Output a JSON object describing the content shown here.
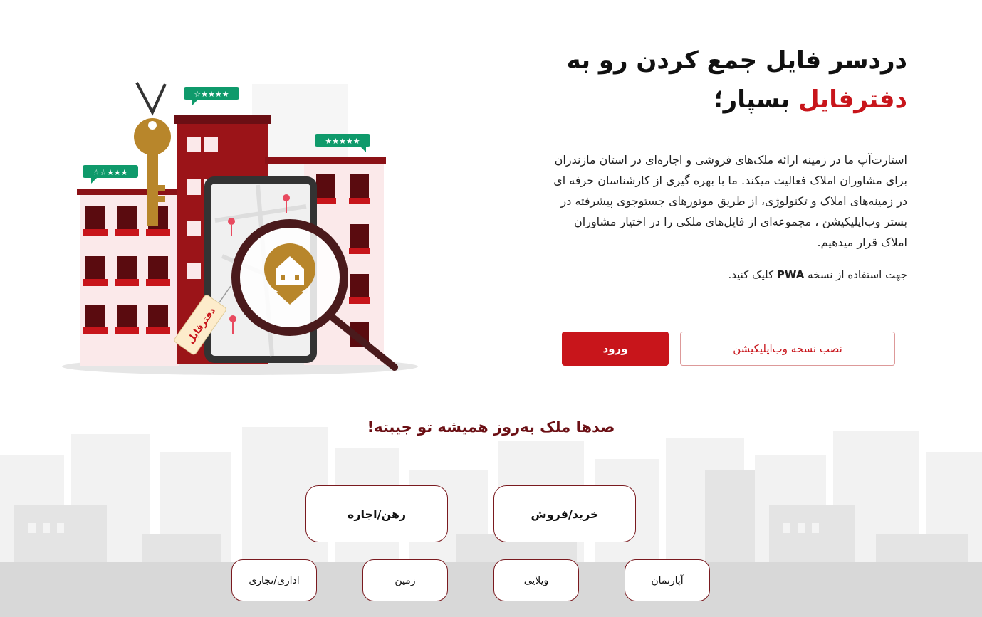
{
  "hero": {
    "headline_line1": "دردسر فایل جمع کردن رو به",
    "headline_brand": "دفترفایل",
    "headline_rest": " بسپار؛",
    "intro": "استارت‌آپ ما در زمینه ارائه ملک‌های فروشی و اجاره‌ای در استان مازندران برای مشاوران املاک فعالیت میکند. ما با بهره گیری از کارشناسان حرفه ای در زمینه‌های املاک و تکنولوژی، از طریق موتورهای جستوجوی پیشرفته در بستر وب‌اپلیکیشن ، مجموعه‌ای از فایل‌های ملکی را در اختیار مشاوران املاک قرار میدهیم.",
    "pwa_prefix": "جهت استفاده از نسخه ",
    "pwa_bold": "PWA",
    "pwa_suffix": " کلیک کنید.",
    "login_label": "ورود",
    "install_label": "نصب نسخه وب‌اپلیکیشن",
    "tag_label": "دفترفایل"
  },
  "colors": {
    "accent": "#c8151b",
    "dark_red": "#6b0f14",
    "brick": "#9b1418"
  },
  "listings": {
    "title": "صدها ملک به‌روز همیشه تو جیبته!",
    "deal_types": [
      "خرید/فروش",
      "رهن/اجاره"
    ],
    "property_types": [
      "آپارتمان",
      "ویلایی",
      "زمین",
      "اداری/تجاری"
    ]
  }
}
